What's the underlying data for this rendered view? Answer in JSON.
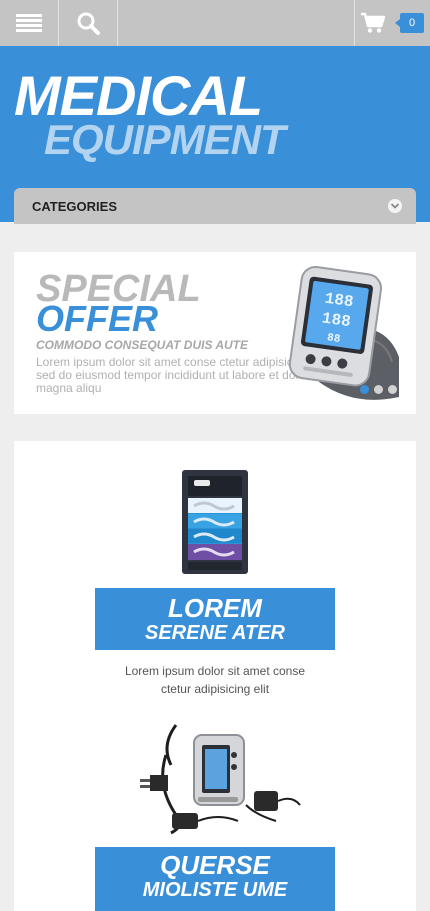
{
  "toolbar": {
    "menu_icon": "hamburger-menu-icon",
    "search_icon": "search-icon",
    "cart_icon": "cart-icon",
    "cart_count": "0"
  },
  "brand": {
    "line1": "MEDICAL",
    "line2": "EQUIPMENT"
  },
  "categories": {
    "label": "CATEGORIES",
    "toggle_icon": "chevron-down-icon"
  },
  "offer": {
    "line1": "SPECIAL",
    "line2": "OFFER",
    "subtitle": "COMMODO CONSEQUAT DUIS AUTE",
    "text": "Lorem ipsum dolor sit amet conse ctetur adipisicing elit, sed do eiusmod tempor incididunt ut labore et dolore magna aliqu",
    "image": "blood-pressure-monitor",
    "slides": 3,
    "active_slide": 1
  },
  "products": [
    {
      "image": "boxed-dental-product",
      "title": "LOREM",
      "subtitle": "SERENE ATER",
      "desc_line1": "Lorem ipsum dolor sit amet conse",
      "desc_line2": "ctetur adipisicing elit"
    },
    {
      "image": "portable-monitor-kit",
      "title": "QUERSE",
      "subtitle": "MIOLISTE UME"
    }
  ],
  "colors": {
    "accent": "#3a8fd9",
    "toolbar": "#c4c4c4",
    "background": "#eeeeee"
  }
}
